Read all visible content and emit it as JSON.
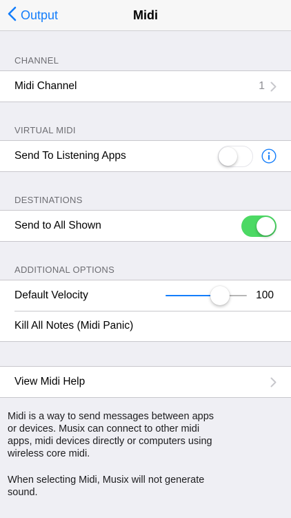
{
  "nav": {
    "back_label": "Output",
    "title": "Midi"
  },
  "channel": {
    "header": "CHANNEL",
    "midi_channel_label": "Midi Channel",
    "midi_channel_value": "1"
  },
  "virtual_midi": {
    "header": "VIRTUAL MIDI",
    "send_to_listening_label": "Send To Listening Apps",
    "send_to_listening_on": false
  },
  "destinations": {
    "header": "DESTINATIONS",
    "send_to_all_label": "Send to All Shown",
    "send_to_all_on": true
  },
  "additional": {
    "header": "ADDITIONAL OPTIONS",
    "velocity_label": "Default Velocity",
    "velocity_value": "100",
    "velocity_fraction": 0.72,
    "kill_notes_label": "Kill All Notes (Midi Panic)"
  },
  "help": {
    "label": "View Midi Help"
  },
  "footer": {
    "paragraph1": "Midi is a way to send messages between apps or devices. Musix can connect to other midi apps, midi devices directly or computers using wireless core midi.",
    "paragraph2": "When selecting Midi, Musix will not generate sound."
  },
  "colors": {
    "accent": "#147efb",
    "toggle_on": "#4cd964",
    "background": "#efeff4"
  }
}
